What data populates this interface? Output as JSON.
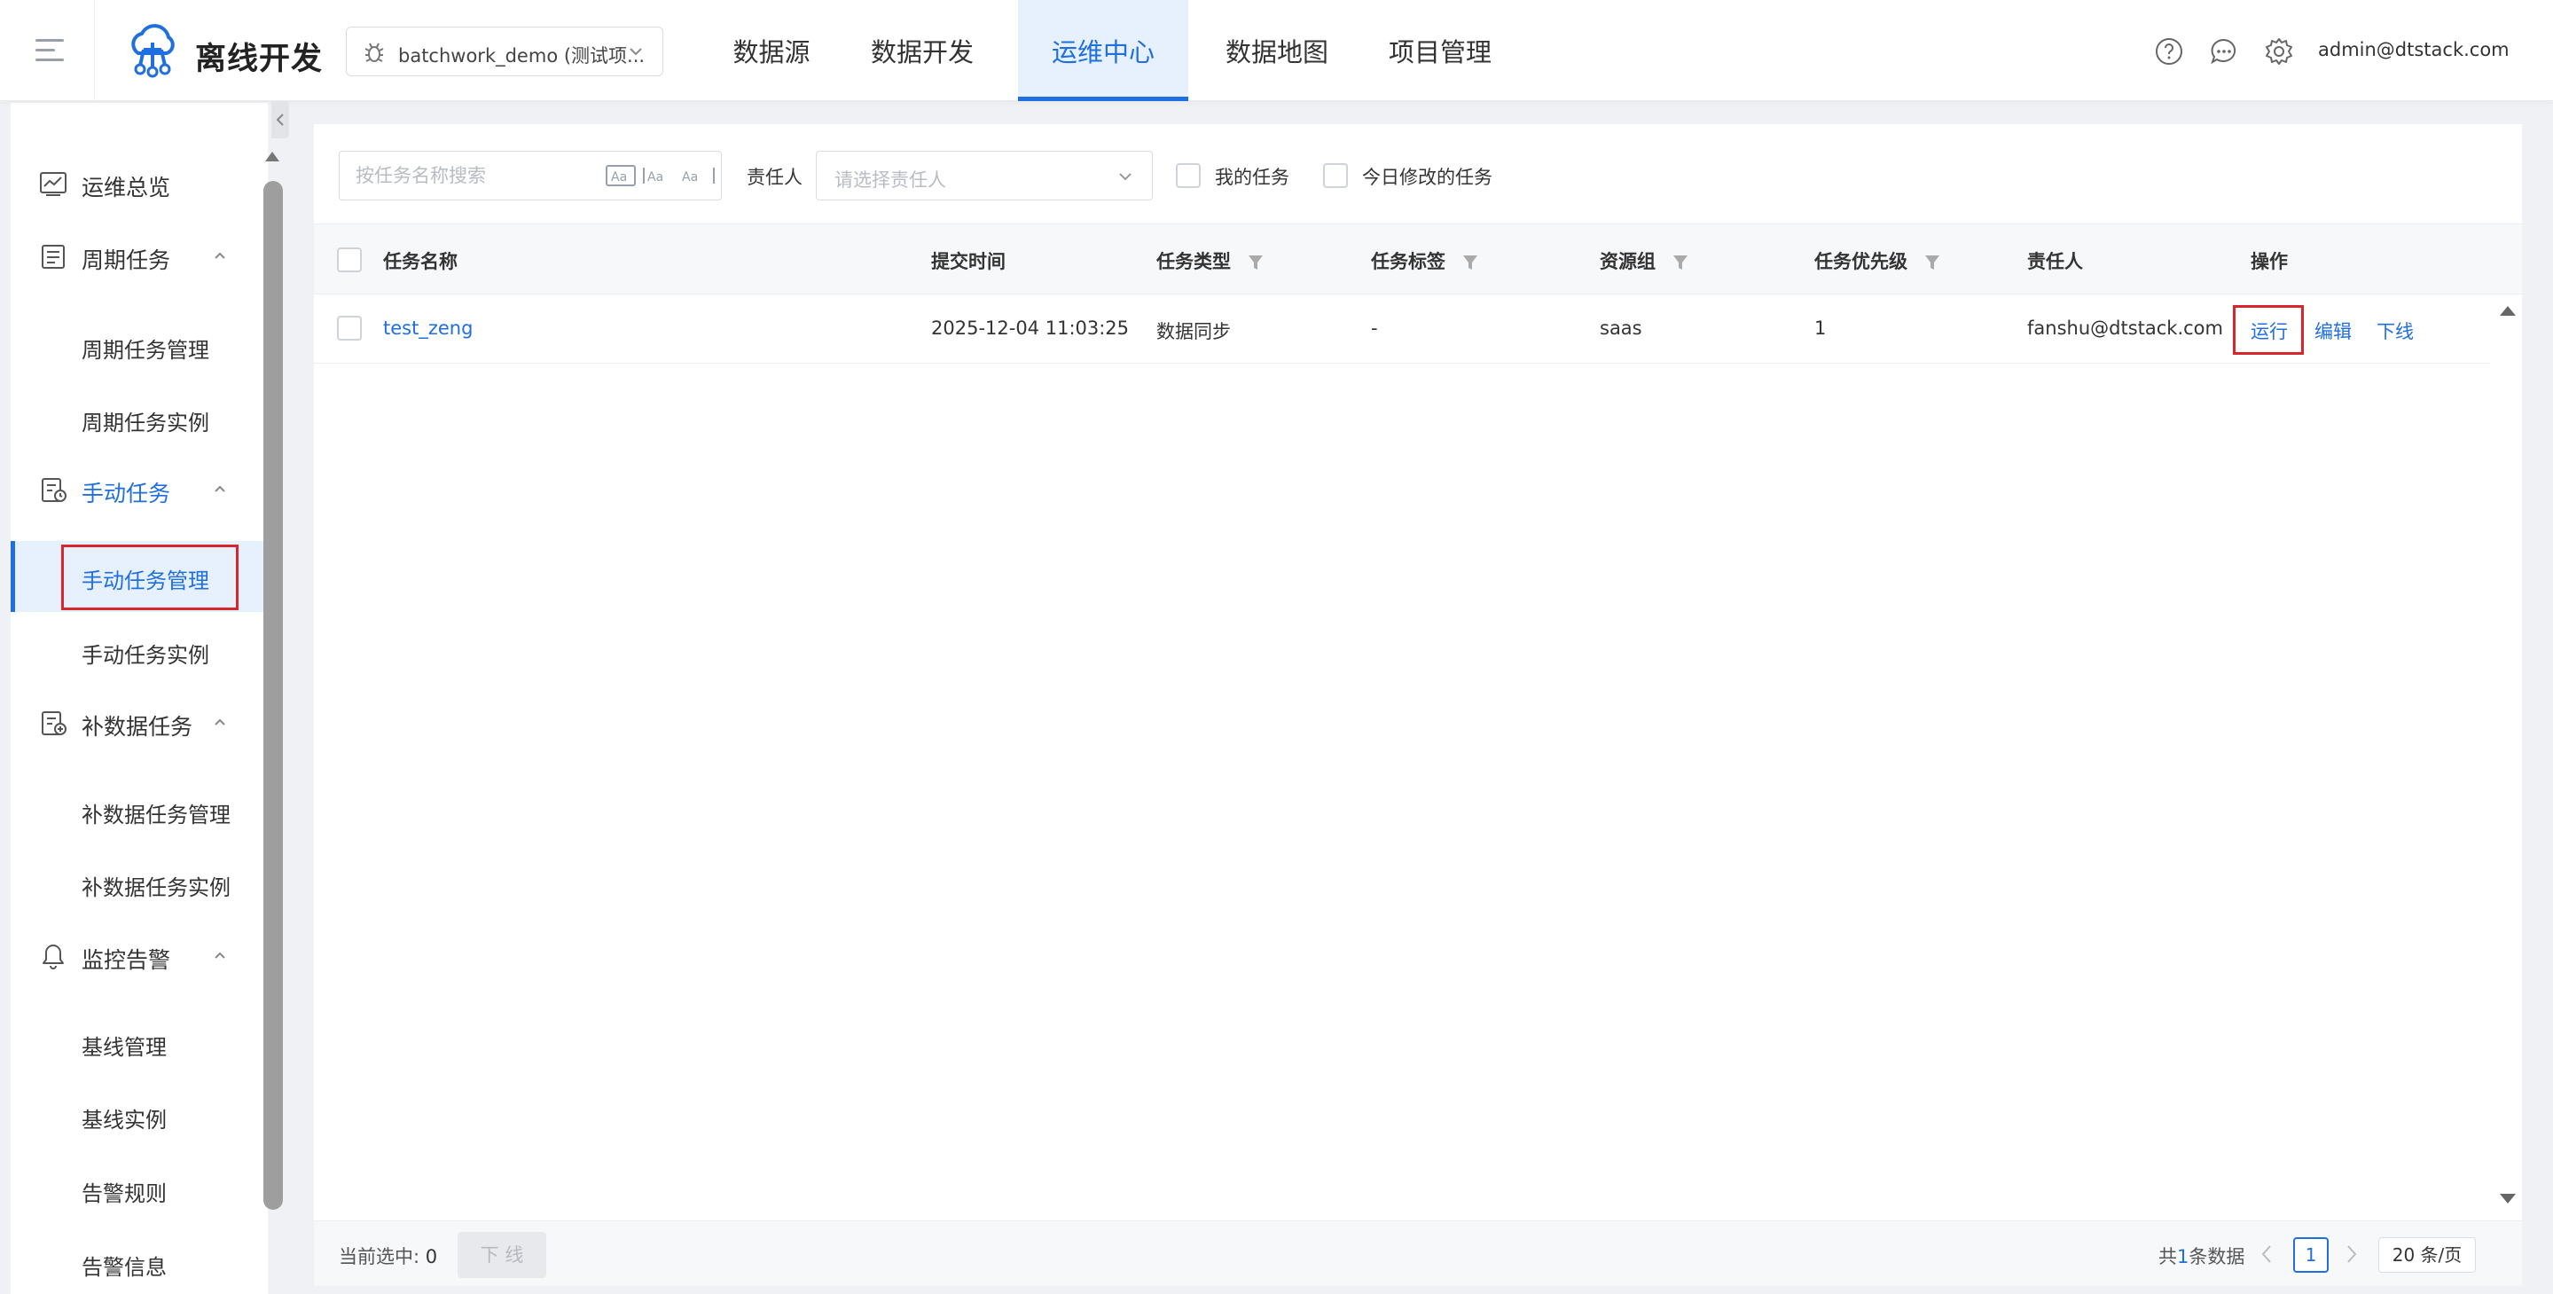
{
  "header": {
    "brand": "离线开发",
    "project": "batchwork_demo (测试项...",
    "nav": [
      {
        "label": "数据源",
        "active": false
      },
      {
        "label": "数据开发",
        "active": false
      },
      {
        "label": "运维中心",
        "active": true
      },
      {
        "label": "数据地图",
        "active": false
      },
      {
        "label": "项目管理",
        "active": false
      }
    ],
    "user": "admin@dtstack.com",
    "icons": [
      "help-icon",
      "message-icon",
      "gear-icon"
    ],
    "accent_color": "#1f6fe0"
  },
  "sidebar": {
    "overview": "运维总览",
    "periodic": {
      "label": "周期任务",
      "items": [
        "周期任务管理",
        "周期任务实例"
      ]
    },
    "manual": {
      "label": "手动任务",
      "items": [
        "手动任务管理",
        "手动任务实例"
      ],
      "selected": "手动任务管理"
    },
    "backfill": {
      "label": "补数据任务",
      "items": [
        "补数据任务管理",
        "补数据任务实例"
      ]
    },
    "monitor": {
      "label": "监控告警",
      "items": [
        "基线管理",
        "基线实例",
        "告警规则",
        "告警信息"
      ]
    }
  },
  "filters": {
    "search_placeholder": "按任务名称搜索",
    "search_value": "",
    "owner_label": "责任人",
    "owner_placeholder": "请选择责任人",
    "my_tasks": "我的任务",
    "today_modified": "今日修改的任务"
  },
  "table": {
    "columns": {
      "name": "任务名称",
      "submit_time": "提交时间",
      "type": "任务类型",
      "tag": "任务标签",
      "resource_group": "资源组",
      "priority": "任务优先级",
      "owner": "责任人",
      "ops": "操作"
    },
    "rows": [
      {
        "name": "test_zeng",
        "submit_time": "2025-12-04 11:03:25",
        "type": "数据同步",
        "tag": "-",
        "resource_group": "saas",
        "priority": "1",
        "owner": "fanshu@dtstack.com",
        "ops": {
          "run": "运行",
          "edit": "编辑",
          "offline": "下线"
        }
      }
    ]
  },
  "footer": {
    "selected_label": "当前选中:",
    "selected_count": "0",
    "offline_button": "下 线",
    "total_prefix": "共",
    "total_count": "1",
    "total_suffix": "条数据",
    "current_page": "1",
    "page_size": "20 条/页"
  }
}
